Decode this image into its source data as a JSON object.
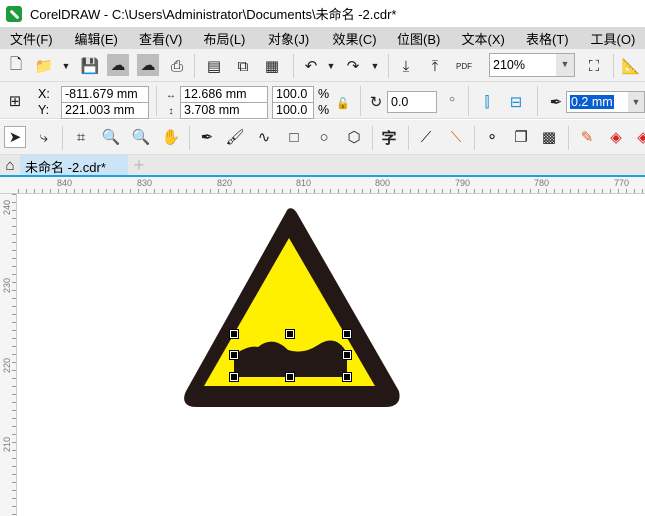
{
  "window": {
    "title": "CorelDRAW - C:\\Users\\Administrator\\Documents\\未命名 -2.cdr*"
  },
  "menu": [
    "文件(F)",
    "编辑(E)",
    "查看(V)",
    "布局(L)",
    "对象(J)",
    "效果(C)",
    "位图(B)",
    "文本(X)",
    "表格(T)",
    "工具(O)"
  ],
  "toolbar": {
    "zoom": "210%",
    "pdf_label": "PDF"
  },
  "properties": {
    "x_label": "X:",
    "y_label": "Y:",
    "x": "-811.679 mm",
    "y": "221.003 mm",
    "width": "12.686 mm",
    "height": "3.708 mm",
    "scale_w": "100.0",
    "scale_h": "100.0",
    "percent": "%",
    "rotation": "0.0",
    "outline": "0.2 mm"
  },
  "toolbox": {
    "text_tool": "字"
  },
  "tabs": {
    "document": "未命名 -2.cdr*",
    "add": "+"
  },
  "rulers": {
    "h": [
      "840",
      "830",
      "820",
      "810",
      "800",
      "790",
      "780",
      "770"
    ],
    "v": [
      "240",
      "230",
      "220",
      "210"
    ]
  },
  "colors": {
    "sign_yellow": "#FFF000",
    "sign_border": "#231815",
    "accent": "#19a2e8"
  }
}
